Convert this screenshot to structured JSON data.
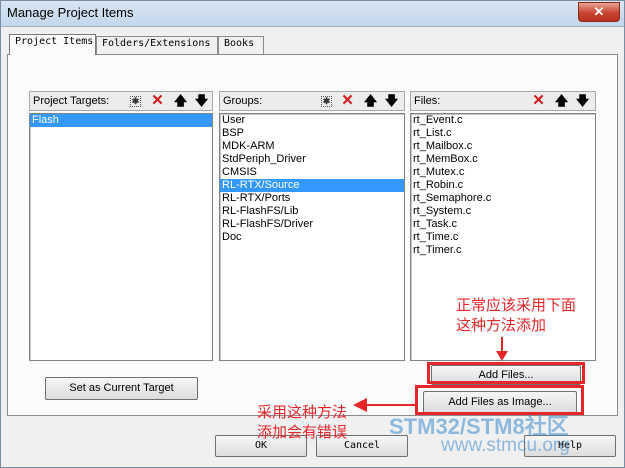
{
  "window": {
    "title": "Manage Project Items",
    "close_label": "✕"
  },
  "tabs": [
    {
      "label": "Project Items"
    },
    {
      "label": "Folders/Extensions"
    },
    {
      "label": "Books"
    }
  ],
  "targets": {
    "label": "Project Targets:",
    "items": [
      "Flash"
    ],
    "selected": "Flash"
  },
  "groups": {
    "label": "Groups:",
    "items": [
      "User",
      "BSP",
      "MDK-ARM",
      "StdPeriph_Driver",
      "CMSIS",
      "RL-RTX/Source",
      "RL-RTX/Ports",
      "RL-FlashFS/Lib",
      "RL-FlashFS/Driver",
      "Doc"
    ],
    "selected": "RL-RTX/Source"
  },
  "files": {
    "label": "Files:",
    "items": [
      "rt_Event.c",
      "rt_List.c",
      "rt_Mailbox.c",
      "rt_MemBox.c",
      "rt_Mutex.c",
      "rt_Robin.c",
      "rt_Semaphore.c",
      "rt_System.c",
      "rt_Task.c",
      "rt_Time.c",
      "rt_Timer.c"
    ]
  },
  "buttons": {
    "set_current_target": "Set as Current Target",
    "add_files": "Add Files...",
    "add_files_as_image": "Add Files as Image...",
    "ok": "OK",
    "cancel": "Cancel",
    "help": "Help"
  },
  "annotations": {
    "correct_line1": "正常应该采用下面",
    "correct_line2": "这种方法添加",
    "wrong_line1": "采用这种方法",
    "wrong_line2": "添加会有错误"
  },
  "watermark": {
    "brand": "STM32/STM8社区",
    "url": "www.stmcu.org"
  },
  "colors": {
    "selection": "#3399ff",
    "annotation": "#e8262a",
    "delete_icon": "#d21a1a"
  }
}
